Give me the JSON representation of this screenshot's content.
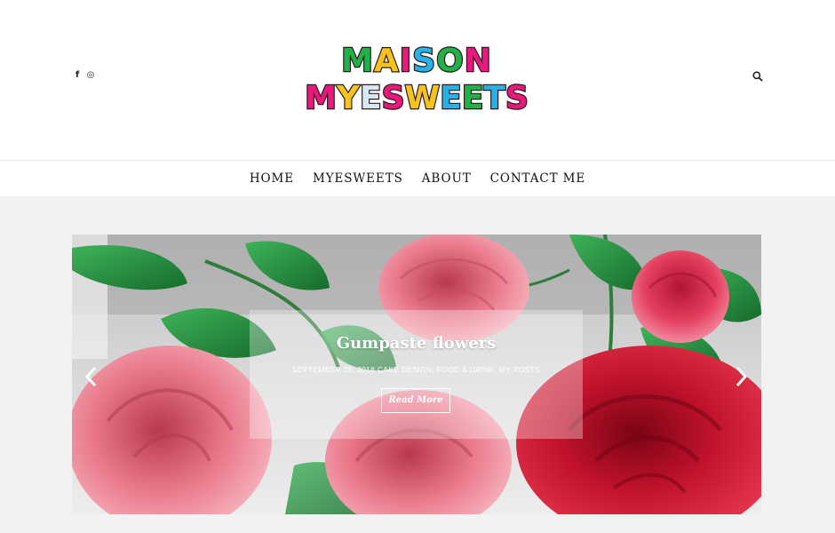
{
  "header": {
    "logo_text_line1": "MAISON",
    "logo_text_line2": "MYESWEETS",
    "social": [
      {
        "icon": "facebook-icon",
        "glyph": "f"
      },
      {
        "icon": "instagram-icon",
        "glyph": "◎"
      }
    ],
    "search_icon": "search-icon"
  },
  "nav": {
    "items": [
      "HOME",
      "MYESWEETS",
      "ABOUT",
      "CONTACT ME"
    ]
  },
  "slider": {
    "title": "Gumpaste flowers",
    "date": "SEPTEMBER 30, 2018",
    "categories": "CAKE DESIGN, FOOD & DRINK, MY POSTS",
    "read_more": "Read More",
    "prev_icon": "chevron-left-icon",
    "next_icon": "chevron-right-icon"
  },
  "colors": {
    "background": "#f2f2f2",
    "header": "#ffffff",
    "text": "#111111",
    "rose_red": "#c3132e",
    "rose_pink": "#e9788a",
    "leaf_green": "#1f8a3b"
  }
}
